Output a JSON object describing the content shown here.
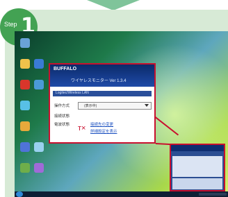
{
  "step": {
    "label": "Step",
    "number": "1"
  },
  "dialog": {
    "brand": "BUFFALO",
    "title": "ワイヤレスモニター Ver 1.3.4",
    "status_bar": "Logitec/Wireless LAN",
    "mode_label": "操作方式",
    "mode_value": "(表示中)",
    "status_label": "接続状態",
    "signal_label": "電波状態",
    "link1": "接続先の変更",
    "link2": "詳細設定を表示"
  },
  "colors": {
    "accent_green": "#43a253",
    "panel_bg": "#d7ead6",
    "highlight_red": "#c8102e"
  }
}
